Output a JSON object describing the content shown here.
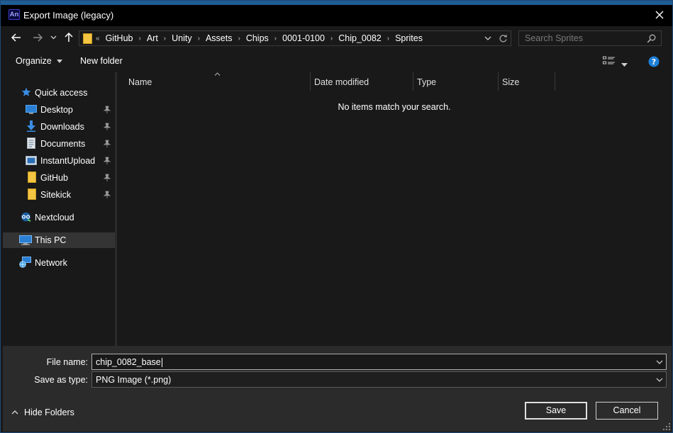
{
  "window": {
    "title": "Export Image (legacy)",
    "app_icon_text": "An"
  },
  "address_bar": {
    "overflow_glyph": "«",
    "crumbs": [
      "GitHub",
      "Art",
      "Unity",
      "Assets",
      "Chips",
      "0001-0100",
      "Chip_0082",
      "Sprites"
    ]
  },
  "search": {
    "placeholder": "Search Sprites"
  },
  "commands": {
    "organize": "Organize",
    "new_folder": "New folder"
  },
  "nav_pane": {
    "items": [
      {
        "label": "Quick access",
        "icon": "star-icon"
      },
      {
        "label": "Desktop",
        "icon": "desktop-icon",
        "pinned": true
      },
      {
        "label": "Downloads",
        "icon": "download-arrow-icon",
        "pinned": true
      },
      {
        "label": "Documents",
        "icon": "document-icon",
        "pinned": true
      },
      {
        "label": "InstantUpload",
        "icon": "image-folder-icon",
        "pinned": true
      },
      {
        "label": "GitHub",
        "icon": "folder-icon",
        "pinned": true
      },
      {
        "label": "Sitekick",
        "icon": "folder-icon",
        "pinned": true
      },
      {
        "label": "Nextcloud",
        "icon": "cloud-icon"
      },
      {
        "label": "This PC",
        "icon": "computer-icon",
        "selected": true
      },
      {
        "label": "Network",
        "icon": "network-icon"
      }
    ]
  },
  "file_list": {
    "columns": [
      "Name",
      "Date modified",
      "Type",
      "Size"
    ],
    "empty_message": "No items match your search."
  },
  "form": {
    "file_name_label": "File name:",
    "file_name_value": "chip_0082_base",
    "save_type_label": "Save as type:",
    "save_type_value": "PNG Image (*.png)"
  },
  "footer": {
    "hide_folders": "Hide Folders",
    "save": "Save",
    "cancel": "Cancel"
  },
  "colors": {
    "background": "#191919",
    "footer_background": "#2b2b2b",
    "selection": "#343434",
    "folder_yellow": "#f4c542",
    "help_blue": "#1e7fd8"
  }
}
